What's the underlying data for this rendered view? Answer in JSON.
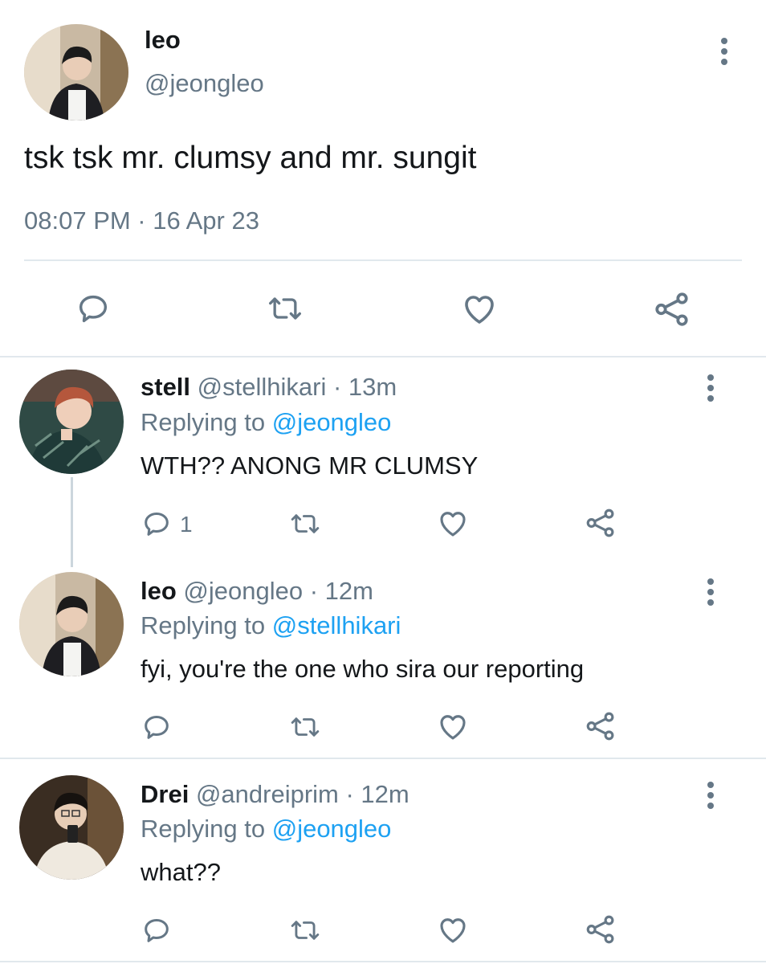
{
  "main_tweet": {
    "display_name": "leo",
    "handle": "@jeongleo",
    "text": "tsk tsk mr. clumsy and mr. sungit",
    "timestamp": "08:07 PM · 16 Apr 23"
  },
  "replies": [
    {
      "display_name": "stell",
      "handle": "@stellhikari",
      "time": "· 13m",
      "replying_prefix": "Replying to",
      "replying_to": "@jeongleo",
      "text": "WTH?? ANONG MR CLUMSY",
      "reply_count": "1"
    },
    {
      "display_name": "leo",
      "handle": "@jeongleo",
      "time": "· 12m",
      "replying_prefix": "Replying to",
      "replying_to": "@stellhikari",
      "text": "fyi, you're the one who sira our reporting",
      "reply_count": ""
    },
    {
      "display_name": "Drei",
      "handle": "@andreiprim",
      "time": "· 12m",
      "replying_prefix": "Replying to",
      "replying_to": "@jeongleo",
      "text": "what??",
      "reply_count": ""
    }
  ],
  "colors": {
    "link": "#1da1f2",
    "secondary_text": "#657786",
    "divider": "#e1e8ed",
    "icon": "#657786"
  },
  "icons": [
    "reply-icon",
    "retweet-icon",
    "like-icon",
    "share-icon",
    "more-options-icon"
  ]
}
